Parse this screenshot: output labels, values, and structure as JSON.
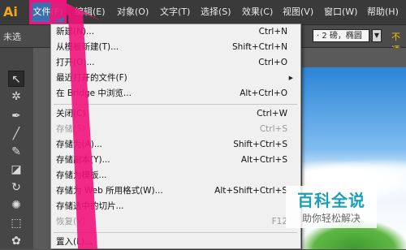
{
  "app": {
    "logo": "Ai"
  },
  "menubar": {
    "items": [
      {
        "label": "文件(F)",
        "active": true
      },
      {
        "label": "编辑(E)"
      },
      {
        "label": "对象(O)"
      },
      {
        "label": "文字(T)"
      },
      {
        "label": "选择(S)"
      },
      {
        "label": "效果(C)"
      },
      {
        "label": "视图(V)"
      },
      {
        "label": "窗口(W)"
      },
      {
        "label": "帮助(H)"
      }
    ]
  },
  "controlbar": {
    "left_label": "未选",
    "stroke_value": "· 2 磅，椭圆",
    "right_label": "不透"
  },
  "file_menu": {
    "items": [
      {
        "label": "新建(N)...",
        "shortcut": "Ctrl+N"
      },
      {
        "label": "从模板新建(T)...",
        "shortcut": "Shift+Ctrl+N"
      },
      {
        "label": "打开(O)...",
        "shortcut": "Ctrl+O"
      },
      {
        "label": "最近打开的文件(F)",
        "shortcut": "",
        "submenu": true
      },
      {
        "label": "在 Bridge 中浏览...",
        "shortcut": "Alt+Ctrl+O"
      },
      {
        "label": "关闭(C)",
        "shortcut": "Ctrl+W"
      },
      {
        "label": "存储(S)",
        "shortcut": "Ctrl+S",
        "disabled": true
      },
      {
        "label": "存储为(A)...",
        "shortcut": "Shift+Ctrl+S"
      },
      {
        "label": "存储副本(Y)...",
        "shortcut": "Alt+Ctrl+S"
      },
      {
        "label": "存储为模板...",
        "shortcut": ""
      },
      {
        "label": "存储为 Web 所用格式(W)...",
        "shortcut": "Alt+Shift+Ctrl+S"
      },
      {
        "label": "存储选中的切片...",
        "shortcut": ""
      },
      {
        "label": "恢复(V)",
        "shortcut": "F12",
        "disabled": true
      },
      {
        "label": "置入(L)...",
        "shortcut": ""
      }
    ]
  },
  "watermark": {
    "title": "百科全说",
    "subtitle": "助你轻松解决"
  },
  "colors": {
    "menubar_bg": "#3a3a3a",
    "highlight": "#f0147a",
    "logo": "#f2a61c",
    "menu_bg": "#f0f0f0",
    "watermark": "#1f9fb6"
  }
}
